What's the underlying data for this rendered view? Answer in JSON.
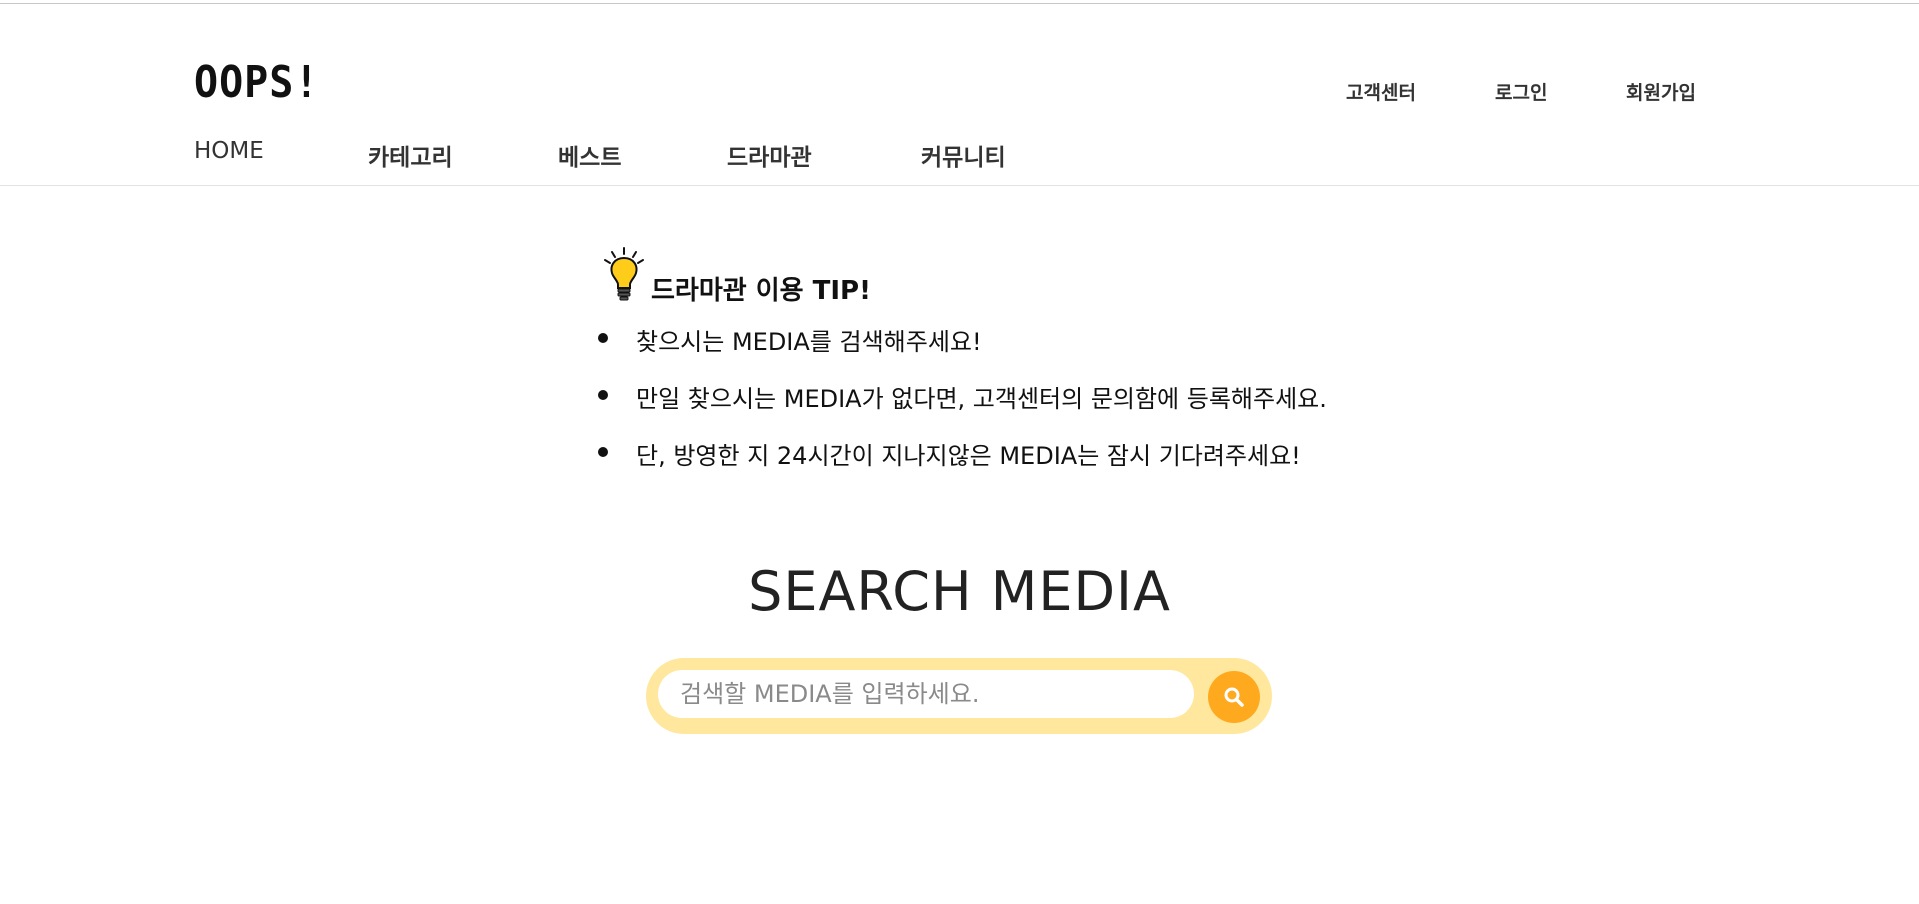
{
  "header": {
    "logo": "OOPS!",
    "util_nav": [
      "고객센터",
      "로그인",
      "회원가입"
    ],
    "main_nav": [
      "HOME",
      "카테고리",
      "베스트",
      "드라마관",
      "커뮤니티"
    ]
  },
  "tip": {
    "icon": "lightbulb-icon",
    "title": "드라마관 이용 TIP!",
    "items": [
      "찾으시는 MEDIA를 검색해주세요!",
      "만일 찾으시는 MEDIA가 없다면, 고객센터의 문의함에 등록해주세요.",
      "단, 방영한 지 24시간이 지나지않은 MEDIA는 잠시 기다려주세요!"
    ]
  },
  "search": {
    "title": "SEARCH MEDIA",
    "placeholder": "검색할 MEDIA를 입력하세요.",
    "value": "",
    "button_icon": "search-icon"
  },
  "colors": {
    "search_bar_bg": "#ffe79e",
    "search_button": "#ffa91f",
    "bulb": "#ffcc1a"
  }
}
